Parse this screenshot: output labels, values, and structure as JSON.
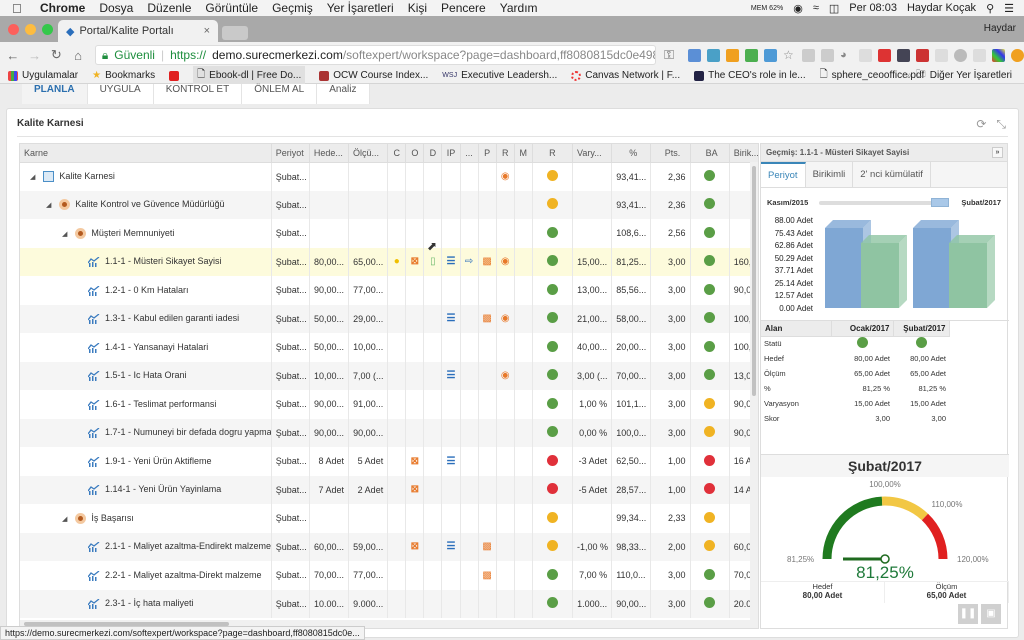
{
  "mac_menu": {
    "app": "Chrome",
    "items": [
      "Dosya",
      "Düzenle",
      "Görüntüle",
      "Geçmiş",
      "Yer İşaretleri",
      "Kişi",
      "Pencere",
      "Yardım"
    ],
    "mem": "MEM 62%",
    "clock": "Per 08:03",
    "user": "Haydar Koçak"
  },
  "browser": {
    "tab_title": "Portal/Kalite Portalı",
    "profile": "Haydar",
    "secure_label": "Güvenli",
    "url_scheme": "https://",
    "url_host": "demo.surecmerkezi.com",
    "url_path": "/softexpert/workspace?page=dashboard,ff8080815dc0e498015dcc2cbe...",
    "bookmarks": [
      "Uygulamalar",
      "Bookmarks",
      "Ebook-dl | Free Do...",
      "OCW Course Index...",
      "Executive Leadersh...",
      "Canvas Network | F...",
      "The CEO's role in le...",
      "sphere_ceooffice.pdf"
    ],
    "other_bookmarks": "Diğer Yer İşaretleri",
    "status_url": "https://demo.surecmerkezi.com/softexpert/workspace?page=dashboard,ff8080815dc0e..."
  },
  "nav_tabs": [
    "PLANLA",
    "UYGULA",
    "KONTROL ET",
    "ÖNLEM AL",
    "Analiz"
  ],
  "panel": {
    "title": "Kalite Karnesi"
  },
  "grid": {
    "columns": [
      "Karne",
      "Periyot",
      "Hede...",
      "Ölçü...",
      "C",
      "O",
      "D",
      "IP",
      "...",
      "P",
      "R",
      "M",
      "R",
      "Vary...",
      "%",
      "Pts.",
      "BA",
      "Birik..."
    ],
    "rows": [
      {
        "level": 0,
        "type": "card",
        "name": "Kalite Karnesi",
        "periyot": "Şubat...",
        "hedef": "",
        "olcum": "",
        "icons": [
          "",
          "",
          "",
          "",
          "",
          "",
          "r",
          ""
        ],
        "r": "#f0b323",
        "vary": "",
        "pct": "93,41...",
        "pts": "2,36",
        "ba": "#5a9e46",
        "birik": ""
      },
      {
        "level": 1,
        "type": "eye",
        "name": "Kalite Kontrol ve Güvence Müdürlüğü",
        "periyot": "Şubat...",
        "hedef": "",
        "olcum": "",
        "icons": [
          "",
          "",
          "",
          "",
          "",
          "",
          "",
          ""
        ],
        "r": "#f0b323",
        "vary": "",
        "pct": "93,41...",
        "pts": "2,36",
        "ba": "#5a9e46",
        "birik": ""
      },
      {
        "level": 2,
        "type": "eye",
        "name": "Müşteri Memnuniyeti",
        "periyot": "Şubat...",
        "hedef": "",
        "olcum": "",
        "icons": [
          "",
          "",
          "",
          "",
          "",
          "",
          "",
          ""
        ],
        "r": "#5a9e46",
        "vary": "",
        "pct": "108,6...",
        "pts": "2,56",
        "ba": "#5a9e46",
        "birik": ""
      },
      {
        "level": 3,
        "type": "kpi",
        "name": "1.1-1 - Müsteri Sikayet Sayisi",
        "periyot": "Şubat...",
        "hedef": "80,00...",
        "olcum": "65,00...",
        "icons": [
          "c",
          "o",
          "d",
          "ip",
          "x",
          "p",
          "r",
          ""
        ],
        "r": "#5a9e46",
        "vary": "15,00...",
        "pct": "81,25...",
        "pts": "3,00",
        "ba": "#5a9e46",
        "birik": "160,0"
      },
      {
        "level": 3,
        "type": "kpi",
        "name": "1.2-1 - 0 Km Hataları",
        "periyot": "Şubat...",
        "hedef": "90,00...",
        "olcum": "77,00...",
        "icons": [
          "",
          "",
          "",
          "",
          "",
          "",
          "",
          ""
        ],
        "r": "#5a9e46",
        "vary": "13,00...",
        "pct": "85,56...",
        "pts": "3,00",
        "ba": "#5a9e46",
        "birik": "90,00"
      },
      {
        "level": 3,
        "type": "kpi",
        "name": "1.3-1 - Kabul edilen garanti iadesi",
        "periyot": "Şubat...",
        "hedef": "50,00...",
        "olcum": "29,00...",
        "icons": [
          "",
          "",
          "",
          "ip",
          "",
          "p",
          "r",
          ""
        ],
        "r": "#5a9e46",
        "vary": "21,00...",
        "pct": "58,00...",
        "pts": "3,00",
        "ba": "#5a9e46",
        "birik": "100,0"
      },
      {
        "level": 3,
        "type": "kpi",
        "name": "1.4-1 - Yansanayi Hatalari",
        "periyot": "Şubat...",
        "hedef": "50,00...",
        "olcum": "10,00...",
        "icons": [
          "",
          "",
          "",
          "",
          "",
          "",
          "",
          ""
        ],
        "r": "#5a9e46",
        "vary": "40,00...",
        "pct": "20,00...",
        "pts": "3,00",
        "ba": "#5a9e46",
        "birik": "100,0"
      },
      {
        "level": 3,
        "type": "kpi",
        "name": "1.5-1 - Ic Hata Orani",
        "periyot": "Şubat...",
        "hedef": "10,00...",
        "olcum": "7,00 (...",
        "icons": [
          "",
          "",
          "",
          "ip",
          "",
          "",
          "r",
          ""
        ],
        "r": "#5a9e46",
        "vary": "3,00 (...",
        "pct": "70,00...",
        "pts": "3,00",
        "ba": "#5a9e46",
        "birik": "13,00"
      },
      {
        "level": 3,
        "type": "kpi",
        "name": "1.6-1 - Teslimat performansi",
        "periyot": "Şubat...",
        "hedef": "90,00...",
        "olcum": "91,00...",
        "icons": [
          "",
          "",
          "",
          "",
          "",
          "",
          "",
          ""
        ],
        "r": "#5a9e46",
        "vary": "1,00 %",
        "pct": "101,1...",
        "pts": "3,00",
        "ba": "#f0b323",
        "birik": "90,00"
      },
      {
        "level": 3,
        "type": "kpi",
        "name": "1.7-1 - Numuneyi bir defada dogru yapma",
        "periyot": "Şubat...",
        "hedef": "90,00...",
        "olcum": "90,00...",
        "icons": [
          "",
          "",
          "",
          "",
          "",
          "",
          "",
          ""
        ],
        "r": "#5a9e46",
        "vary": "0,00 %",
        "pct": "100,0...",
        "pts": "3,00",
        "ba": "#f0b323",
        "birik": "90,00"
      },
      {
        "level": 3,
        "type": "kpi",
        "name": "1.9-1 - Yeni Ürün Aktifleme",
        "periyot": "Şubat...",
        "hedef": "8 Adet",
        "olcum": "5 Adet",
        "icons": [
          "",
          "o",
          "",
          "ip",
          "",
          "",
          "",
          ""
        ],
        "r": "#e0303a",
        "vary": "-3 Adet",
        "pct": "62,50...",
        "pts": "1,00",
        "ba": "#e0303a",
        "birik": "16 Ad"
      },
      {
        "level": 3,
        "type": "kpi",
        "name": "1.14-1 - Yeni Ürün Yayinlama",
        "periyot": "Şubat...",
        "hedef": "7 Adet",
        "olcum": "2 Adet",
        "icons": [
          "",
          "o",
          "",
          "",
          "",
          "",
          "",
          ""
        ],
        "r": "#e0303a",
        "vary": "-5 Adet",
        "pct": "28,57...",
        "pts": "1,00",
        "ba": "#e0303a",
        "birik": "14 Ad"
      },
      {
        "level": 2,
        "type": "eye",
        "name": "İş Başarısı",
        "periyot": "Şubat...",
        "hedef": "",
        "olcum": "",
        "icons": [
          "",
          "",
          "",
          "",
          "",
          "",
          "",
          ""
        ],
        "r": "#f0b323",
        "vary": "",
        "pct": "99,34...",
        "pts": "2,33",
        "ba": "#f0b323",
        "birik": ""
      },
      {
        "level": 3,
        "type": "kpi",
        "name": "2.1-1 - Maliyet azaltma-Endirekt malzeme",
        "periyot": "Şubat...",
        "hedef": "60,00...",
        "olcum": "59,00...",
        "icons": [
          "",
          "o",
          "",
          "ip",
          "",
          "p",
          "",
          ""
        ],
        "r": "#f0b323",
        "vary": "-1,00 %",
        "pct": "98,33...",
        "pts": "2,00",
        "ba": "#f0b323",
        "birik": "60,00"
      },
      {
        "level": 3,
        "type": "kpi",
        "name": "2.2-1 - Maliyet azaltma-Direkt malzeme",
        "periyot": "Şubat...",
        "hedef": "70,00...",
        "olcum": "77,00...",
        "icons": [
          "",
          "",
          "",
          "",
          "",
          "p",
          "",
          ""
        ],
        "r": "#5a9e46",
        "vary": "7,00 %",
        "pct": "110,0...",
        "pts": "3,00",
        "ba": "#5a9e46",
        "birik": "70,00"
      },
      {
        "level": 3,
        "type": "kpi",
        "name": "2.3-1 - İç hata maliyeti",
        "periyot": "Şubat...",
        "hedef": "10.00...",
        "olcum": "9.000...",
        "icons": [
          "",
          "",
          "",
          "",
          "",
          "",
          "",
          ""
        ],
        "r": "#5a9e46",
        "vary": "1.000...",
        "pct": "90,00...",
        "pts": "3,00",
        "ba": "#5a9e46",
        "birik": "20.00"
      }
    ]
  },
  "history": {
    "title": "Geçmiş: 1.1-1 - Müsteri Sikayet Sayisi",
    "tabs": [
      "Periyot",
      "Birikimli",
      "2' nci kümülatif"
    ],
    "range_start": "Kasım/2015",
    "range_end": "Şubat/2017",
    "y_labels": [
      "88.00 Adet",
      "75.43 Adet",
      "62.86 Adet",
      "50.29 Adet",
      "37.71 Adet",
      "25.14 Adet",
      "12.57 Adet",
      "0.00 Adet"
    ],
    "bars": [
      {
        "period": "Ocak/2017",
        "hedef": 80,
        "olcum": 65
      },
      {
        "period": "Şubat/2017",
        "hedef": 80,
        "olcum": 65
      }
    ],
    "y_max": 88,
    "bar_colors": {
      "hedef": "#7fa7d4",
      "olcum": "#8fc4a2"
    },
    "table": {
      "headers": [
        "Alan",
        "Ocak/2017",
        "Şubat/2017"
      ],
      "rows": [
        {
          "label": "Statü",
          "v1": "",
          "v2": "",
          "status": "#5a9e46"
        },
        {
          "label": "Hedef",
          "v1": "80,00 Adet",
          "v2": "80,00 Adet"
        },
        {
          "label": "Ölçüm",
          "v1": "65,00 Adet",
          "v2": "65,00 Adet"
        },
        {
          "label": "%",
          "v1": "81,25 %",
          "v2": "81,25 %"
        },
        {
          "label": "Varyasyon",
          "v1": "15,00 Adet",
          "v2": "15,00 Adet"
        },
        {
          "label": "Skor",
          "v1": "3,00",
          "v2": "3,00"
        }
      ]
    },
    "gauge": {
      "title": "Şubat/2017",
      "min_label": "81,25%",
      "top_label": "100,00%",
      "mid_label": "110,00%",
      "max_label": "120,00%",
      "value_label": "81,25%",
      "value": 81.25,
      "min": 81.25,
      "max": 120,
      "bands": [
        {
          "from": 81.25,
          "to": 100,
          "color": "#1f7a1f"
        },
        {
          "from": 100,
          "to": 110,
          "color": "#f2c744"
        },
        {
          "from": 110,
          "to": 120,
          "color": "#e02020"
        }
      ],
      "hedef_label": "Hedef",
      "hedef_value": "80,00 Adet",
      "olcum_label": "Ölçüm",
      "olcum_value": "65,00 Adet"
    }
  }
}
